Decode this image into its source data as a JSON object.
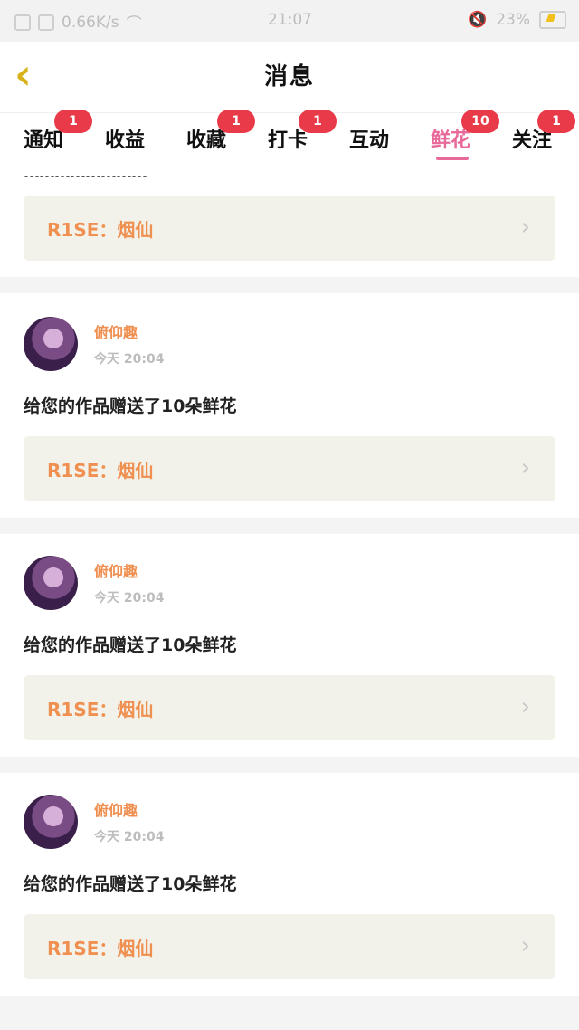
{
  "status_bar": {
    "network_speed": "0.66K/s",
    "time": "21:07",
    "battery": "23%"
  },
  "header": {
    "title": "消息"
  },
  "tabs": [
    {
      "label": "通知",
      "badge": "1",
      "active": false
    },
    {
      "label": "收益",
      "badge": "",
      "active": false
    },
    {
      "label": "收藏",
      "badge": "1",
      "active": false
    },
    {
      "label": "打卡",
      "badge": "1",
      "active": false
    },
    {
      "label": "互动",
      "badge": "",
      "active": false
    },
    {
      "label": "鲜花",
      "badge": "10",
      "active": true
    },
    {
      "label": "关注",
      "badge": "1",
      "active": false
    }
  ],
  "top_partial": {
    "work": "R1SE：烟仙"
  },
  "messages": [
    {
      "user": "俯仰趣",
      "time_prefix": "今天",
      "time": "20:04",
      "text": "给您的作品赠送了10朵鲜花",
      "work": "R1SE：烟仙"
    },
    {
      "user": "俯仰趣",
      "time_prefix": "今天",
      "time": "20:04",
      "text": "给您的作品赠送了10朵鲜花",
      "work": "R1SE：烟仙"
    },
    {
      "user": "俯仰趣",
      "time_prefix": "今天",
      "time": "20:04",
      "text": "给您的作品赠送了10朵鲜花",
      "work": "R1SE：烟仙"
    }
  ],
  "colors": {
    "accent": "#ef8f50",
    "active_tab": "#e86a9a",
    "badge": "#e83a48"
  }
}
